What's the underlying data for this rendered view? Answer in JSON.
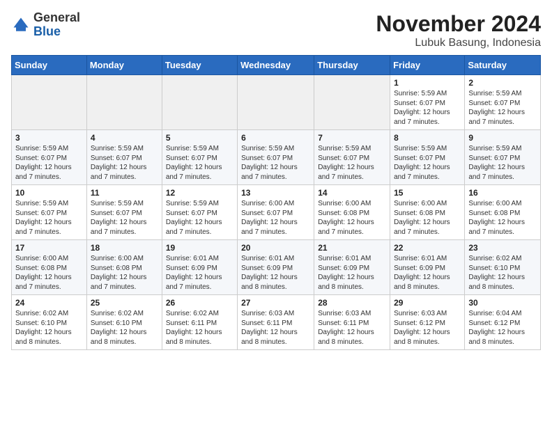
{
  "logo": {
    "general": "General",
    "blue": "Blue"
  },
  "title": "November 2024",
  "subtitle": "Lubuk Basung, Indonesia",
  "days_of_week": [
    "Sunday",
    "Monday",
    "Tuesday",
    "Wednesday",
    "Thursday",
    "Friday",
    "Saturday"
  ],
  "weeks": [
    [
      {
        "day": "",
        "info": ""
      },
      {
        "day": "",
        "info": ""
      },
      {
        "day": "",
        "info": ""
      },
      {
        "day": "",
        "info": ""
      },
      {
        "day": "",
        "info": ""
      },
      {
        "day": "1",
        "info": "Sunrise: 5:59 AM\nSunset: 6:07 PM\nDaylight: 12 hours\nand 7 minutes."
      },
      {
        "day": "2",
        "info": "Sunrise: 5:59 AM\nSunset: 6:07 PM\nDaylight: 12 hours\nand 7 minutes."
      }
    ],
    [
      {
        "day": "3",
        "info": "Sunrise: 5:59 AM\nSunset: 6:07 PM\nDaylight: 12 hours\nand 7 minutes."
      },
      {
        "day": "4",
        "info": "Sunrise: 5:59 AM\nSunset: 6:07 PM\nDaylight: 12 hours\nand 7 minutes."
      },
      {
        "day": "5",
        "info": "Sunrise: 5:59 AM\nSunset: 6:07 PM\nDaylight: 12 hours\nand 7 minutes."
      },
      {
        "day": "6",
        "info": "Sunrise: 5:59 AM\nSunset: 6:07 PM\nDaylight: 12 hours\nand 7 minutes."
      },
      {
        "day": "7",
        "info": "Sunrise: 5:59 AM\nSunset: 6:07 PM\nDaylight: 12 hours\nand 7 minutes."
      },
      {
        "day": "8",
        "info": "Sunrise: 5:59 AM\nSunset: 6:07 PM\nDaylight: 12 hours\nand 7 minutes."
      },
      {
        "day": "9",
        "info": "Sunrise: 5:59 AM\nSunset: 6:07 PM\nDaylight: 12 hours\nand 7 minutes."
      }
    ],
    [
      {
        "day": "10",
        "info": "Sunrise: 5:59 AM\nSunset: 6:07 PM\nDaylight: 12 hours\nand 7 minutes."
      },
      {
        "day": "11",
        "info": "Sunrise: 5:59 AM\nSunset: 6:07 PM\nDaylight: 12 hours\nand 7 minutes."
      },
      {
        "day": "12",
        "info": "Sunrise: 5:59 AM\nSunset: 6:07 PM\nDaylight: 12 hours\nand 7 minutes."
      },
      {
        "day": "13",
        "info": "Sunrise: 6:00 AM\nSunset: 6:07 PM\nDaylight: 12 hours\nand 7 minutes."
      },
      {
        "day": "14",
        "info": "Sunrise: 6:00 AM\nSunset: 6:08 PM\nDaylight: 12 hours\nand 7 minutes."
      },
      {
        "day": "15",
        "info": "Sunrise: 6:00 AM\nSunset: 6:08 PM\nDaylight: 12 hours\nand 7 minutes."
      },
      {
        "day": "16",
        "info": "Sunrise: 6:00 AM\nSunset: 6:08 PM\nDaylight: 12 hours\nand 7 minutes."
      }
    ],
    [
      {
        "day": "17",
        "info": "Sunrise: 6:00 AM\nSunset: 6:08 PM\nDaylight: 12 hours\nand 7 minutes."
      },
      {
        "day": "18",
        "info": "Sunrise: 6:00 AM\nSunset: 6:08 PM\nDaylight: 12 hours\nand 7 minutes."
      },
      {
        "day": "19",
        "info": "Sunrise: 6:01 AM\nSunset: 6:09 PM\nDaylight: 12 hours\nand 7 minutes."
      },
      {
        "day": "20",
        "info": "Sunrise: 6:01 AM\nSunset: 6:09 PM\nDaylight: 12 hours\nand 8 minutes."
      },
      {
        "day": "21",
        "info": "Sunrise: 6:01 AM\nSunset: 6:09 PM\nDaylight: 12 hours\nand 8 minutes."
      },
      {
        "day": "22",
        "info": "Sunrise: 6:01 AM\nSunset: 6:09 PM\nDaylight: 12 hours\nand 8 minutes."
      },
      {
        "day": "23",
        "info": "Sunrise: 6:02 AM\nSunset: 6:10 PM\nDaylight: 12 hours\nand 8 minutes."
      }
    ],
    [
      {
        "day": "24",
        "info": "Sunrise: 6:02 AM\nSunset: 6:10 PM\nDaylight: 12 hours\nand 8 minutes."
      },
      {
        "day": "25",
        "info": "Sunrise: 6:02 AM\nSunset: 6:10 PM\nDaylight: 12 hours\nand 8 minutes."
      },
      {
        "day": "26",
        "info": "Sunrise: 6:02 AM\nSunset: 6:11 PM\nDaylight: 12 hours\nand 8 minutes."
      },
      {
        "day": "27",
        "info": "Sunrise: 6:03 AM\nSunset: 6:11 PM\nDaylight: 12 hours\nand 8 minutes."
      },
      {
        "day": "28",
        "info": "Sunrise: 6:03 AM\nSunset: 6:11 PM\nDaylight: 12 hours\nand 8 minutes."
      },
      {
        "day": "29",
        "info": "Sunrise: 6:03 AM\nSunset: 6:12 PM\nDaylight: 12 hours\nand 8 minutes."
      },
      {
        "day": "30",
        "info": "Sunrise: 6:04 AM\nSunset: 6:12 PM\nDaylight: 12 hours\nand 8 minutes."
      }
    ]
  ]
}
